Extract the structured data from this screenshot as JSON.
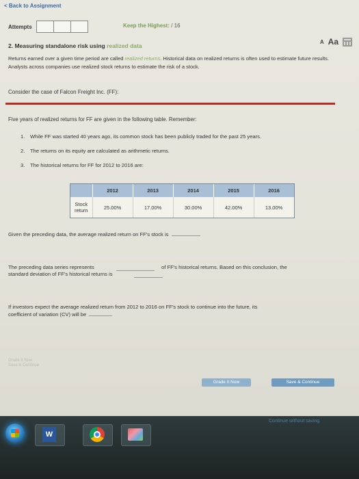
{
  "nav": {
    "back_label": "< Back to Assignment"
  },
  "attempts": {
    "label": "Attempts",
    "keep_prefix": "Keep the Highest:",
    "keep_value": " / 16"
  },
  "question": {
    "title_prefix": "2. Measuring standalone risk using ",
    "title_accent": "realized data",
    "text_small": "A",
    "text_large": "Aa",
    "intro_1": "Returns earned over a given time period are called ",
    "intro_term": "realized returns",
    "intro_2": ". Historical data on realized returns is often used to estimate future results. Analysts across companies use realized stock returns to estimate the risk of a stock.",
    "case": "Consider the case of Falcon Freight Inc. (FF):",
    "given": "Five years of realized returns for FF are given in the following table. Remember:",
    "list": [
      {
        "num": "1.",
        "text": "While FF was started 40 years ago, its common stock has been publicly traded for the past 25 years."
      },
      {
        "num": "2.",
        "text": "The returns on its equity are calculated as arithmetic returns."
      },
      {
        "num": "3.",
        "text": "The historical returns for FF for 2012 to 2016 are:"
      }
    ]
  },
  "returns_table": {
    "years": [
      "2012",
      "2013",
      "2014",
      "2015",
      "2016"
    ],
    "row_label": "Stock return",
    "values": [
      "25.00%",
      "17.00%",
      "30.00%",
      "42.00%",
      "13.00%"
    ]
  },
  "prompts": {
    "avg": "Given the preceding data, the average realized return on FF's stock is",
    "series_1": "The preceding data series represents",
    "series_2": "of FF's historical returns. Based on this conclusion, the",
    "series_3": "standard deviation of FF's historical returns is",
    "cv_1": "If investors expect the average realized return from 2012 to 2016 on FF's stock to continue into the future, its",
    "cv_2": "coefficient of variation (CV) will be"
  },
  "footer": {
    "faded_1": "Grade It Now",
    "faded_2": "Save & Continue",
    "grade_button": "Grade It Now",
    "save_button": "Save & Continue",
    "continue_link": "Continue without saving"
  },
  "taskbar": {
    "word_letter": "W"
  },
  "colors": {
    "accent_green": "#8aa86a",
    "rule_red": "#b42b1f",
    "table_header": "#a9bfd5",
    "button_blue": "#6f9bbf"
  }
}
